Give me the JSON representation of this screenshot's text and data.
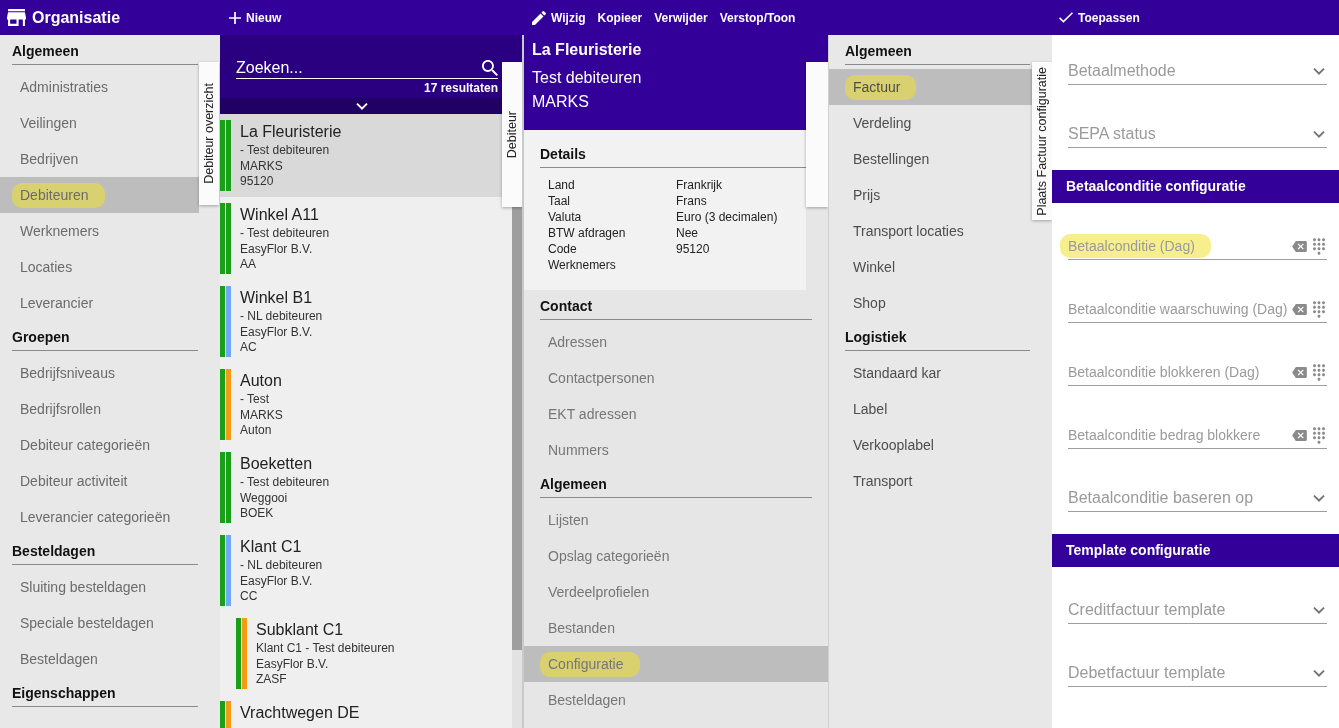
{
  "top_bar": {
    "title": "Organisatie",
    "list_actions": [
      {
        "label": "Nieuw",
        "kind": "add"
      }
    ],
    "detail_actions": [
      {
        "label": "Wijzig",
        "kind": "edit"
      },
      {
        "label": "Kopieer",
        "kind": "copy"
      },
      {
        "label": "Verwijder",
        "kind": "delete"
      },
      {
        "label": "Verstop/Toon",
        "kind": "toggle"
      }
    ],
    "form_actions": [
      {
        "label": "Toepassen",
        "kind": "apply"
      }
    ]
  },
  "sidebar": {
    "tab": "Debiteur overzicht",
    "groups": [
      {
        "title": "Algemeen",
        "items": [
          {
            "label": "Administraties",
            "selected": false,
            "highlighted": false
          },
          {
            "label": "Veilingen",
            "selected": false,
            "highlighted": false
          },
          {
            "label": "Bedrijven",
            "selected": false,
            "highlighted": false
          },
          {
            "label": "Debiteuren",
            "selected": true,
            "highlighted": true
          },
          {
            "label": "Werknemers",
            "selected": false,
            "highlighted": false
          },
          {
            "label": "Locaties",
            "selected": false,
            "highlighted": false
          },
          {
            "label": "Leverancier",
            "selected": false,
            "highlighted": false
          }
        ]
      },
      {
        "title": "Groepen",
        "items": [
          {
            "label": "Bedrijfsniveaus",
            "selected": false,
            "highlighted": false
          },
          {
            "label": "Bedrijfsrollen",
            "selected": false,
            "highlighted": false
          },
          {
            "label": "Debiteur categorieën",
            "selected": false,
            "highlighted": false
          },
          {
            "label": "Debiteur activiteit",
            "selected": false,
            "highlighted": false
          },
          {
            "label": "Leverancier categorieën",
            "selected": false,
            "highlighted": false
          }
        ]
      },
      {
        "title": "Besteldagen",
        "items": [
          {
            "label": "Sluiting besteldagen",
            "selected": false,
            "highlighted": false
          },
          {
            "label": "Speciale besteldagen",
            "selected": false,
            "highlighted": false
          },
          {
            "label": "Besteldagen",
            "selected": false,
            "highlighted": false
          }
        ]
      },
      {
        "title": "Eigenschappen"
      }
    ]
  },
  "debtor_list": {
    "search": {
      "placeholder": "Zoeken..."
    },
    "result_count": "17 resultaten",
    "tab": "Debiteur",
    "items": [
      {
        "name": "La Fleuristerie",
        "lines": [
          "- Test debiteuren",
          "MARKS",
          "95120"
        ],
        "bars": [
          {
            "color": "#19a019"
          },
          {
            "color": "#19a019"
          }
        ],
        "selected": true
      },
      {
        "name": "Winkel A11",
        "lines": [
          "- Test debiteuren",
          "EasyFlor B.V.",
          "AA"
        ],
        "bars": [
          {
            "color": "#19a019"
          },
          {
            "color": "#19a019"
          }
        ],
        "selected": false
      },
      {
        "name": "Winkel B1",
        "lines": [
          "- NL debiteuren",
          "EasyFlor B.V.",
          "AC"
        ],
        "bars": [
          {
            "color": "#19a019"
          },
          {
            "color": "#6ea8f7"
          }
        ],
        "selected": false
      },
      {
        "name": "Auton",
        "lines": [
          "- Test",
          "MARKS",
          "Auton"
        ],
        "bars": [
          {
            "color": "#19a019"
          },
          {
            "color": "#f29b13"
          }
        ],
        "selected": false
      },
      {
        "name": "Boeketten",
        "lines": [
          "- Test debiteuren",
          "Weggooi",
          "BOEK"
        ],
        "bars": [
          {
            "color": "#19a019"
          },
          {
            "color": "#19a019"
          }
        ],
        "selected": false
      },
      {
        "name": "Klant C1",
        "lines": [
          "- NL debiteuren",
          "EasyFlor B.V.",
          "CC"
        ],
        "bars": [
          {
            "color": "#19a019"
          },
          {
            "color": "#6ea8f7"
          }
        ],
        "selected": false,
        "children": [
          {
            "name": "Subklant C1",
            "lines": [
              "Klant C1 - Test debiteuren",
              "EasyFlor B.V.",
              "ZASF"
            ],
            "bars": [
              {
                "color": "#19a019"
              },
              {
                "color": "#f29b13"
              }
            ],
            "selected": false
          }
        ]
      },
      {
        "name": "Vrachtwegen DE",
        "bars": [
          {
            "color": "#19a019"
          },
          {
            "color": "#f29b13"
          }
        ],
        "selected": false
      }
    ]
  },
  "detail": {
    "header": {
      "title": "La Fleuristerie",
      "lines": [
        "Test debiteuren",
        "MARKS"
      ]
    },
    "details": {
      "title": "Details",
      "rows": [
        {
          "label": "Land",
          "value": "Frankrijk"
        },
        {
          "label": "Taal",
          "value": "Frans"
        },
        {
          "label": "Valuta",
          "value": "Euro (3 decimalen)"
        },
        {
          "label": "BTW afdragen",
          "value": "Nee"
        },
        {
          "label": "Code",
          "value": "95120"
        },
        {
          "label": "Werknemers"
        }
      ]
    },
    "groups": [
      {
        "title": "Contact",
        "items": [
          {
            "label": "Adressen",
            "selected": false,
            "highlighted": false
          },
          {
            "label": "Contactpersonen",
            "selected": false,
            "highlighted": false
          },
          {
            "label": "EKT adressen",
            "selected": false,
            "highlighted": false
          },
          {
            "label": "Nummers",
            "selected": false,
            "highlighted": false
          }
        ]
      },
      {
        "title": "Algemeen",
        "items": [
          {
            "label": "Lijsten",
            "selected": false,
            "highlighted": false
          },
          {
            "label": "Opslag categorieën",
            "selected": false,
            "highlighted": false
          },
          {
            "label": "Verdeelprofielen",
            "selected": false,
            "highlighted": false
          },
          {
            "label": "Bestanden",
            "selected": false,
            "highlighted": false
          },
          {
            "label": "Configuratie",
            "selected": true,
            "highlighted": true
          },
          {
            "label": "Besteldagen",
            "selected": false,
            "highlighted": false
          }
        ]
      }
    ]
  },
  "config_nav": {
    "tab": "Plaats Factuur configuratie",
    "groups": [
      {
        "title": "Algemeen",
        "items": [
          {
            "label": "Factuur",
            "selected": true,
            "highlighted": true
          },
          {
            "label": "Verdeling",
            "selected": false,
            "highlighted": false
          },
          {
            "label": "Bestellingen",
            "selected": false,
            "highlighted": false
          },
          {
            "label": "Prijs",
            "selected": false,
            "highlighted": false
          },
          {
            "label": "Transport locaties",
            "selected": false,
            "highlighted": false
          },
          {
            "label": "Winkel",
            "selected": false,
            "highlighted": false
          },
          {
            "label": "Shop",
            "selected": false,
            "highlighted": false
          }
        ]
      },
      {
        "title": "Logistiek",
        "items": [
          {
            "label": "Standaard kar",
            "selected": false,
            "highlighted": false
          },
          {
            "label": "Label",
            "selected": false,
            "highlighted": false
          },
          {
            "label": "Verkooplabel",
            "selected": false,
            "highlighted": false
          },
          {
            "label": "Transport",
            "selected": false,
            "highlighted": false
          }
        ]
      }
    ]
  },
  "form": {
    "sections": [
      {
        "fields": [
          {
            "kind": "select",
            "label": "Betaalmethode",
            "highlighted": false
          },
          {
            "kind": "select",
            "label": "SEPA status",
            "highlighted": false
          }
        ]
      },
      {
        "title": "Betaalconditie configuratie",
        "fields": [
          {
            "kind": "number",
            "label": "Betaalconditie (Dag)",
            "highlighted": true
          },
          {
            "kind": "number",
            "label": "Betaalconditie waarschuwing (Dag)",
            "highlighted": false
          },
          {
            "kind": "number",
            "label": "Betaalconditie blokkeren (Dag)",
            "highlighted": false
          },
          {
            "kind": "number",
            "label": "Betaalconditie bedrag blokkere",
            "highlighted": false
          },
          {
            "kind": "select",
            "label": "Betaalconditie baseren op",
            "highlighted": false
          }
        ]
      },
      {
        "title": "Template configuratie",
        "fields": [
          {
            "kind": "select",
            "label": "Creditfactuur template",
            "highlighted": false
          },
          {
            "kind": "select",
            "label": "Debetfactuur template",
            "highlighted": false
          }
        ]
      }
    ]
  }
}
